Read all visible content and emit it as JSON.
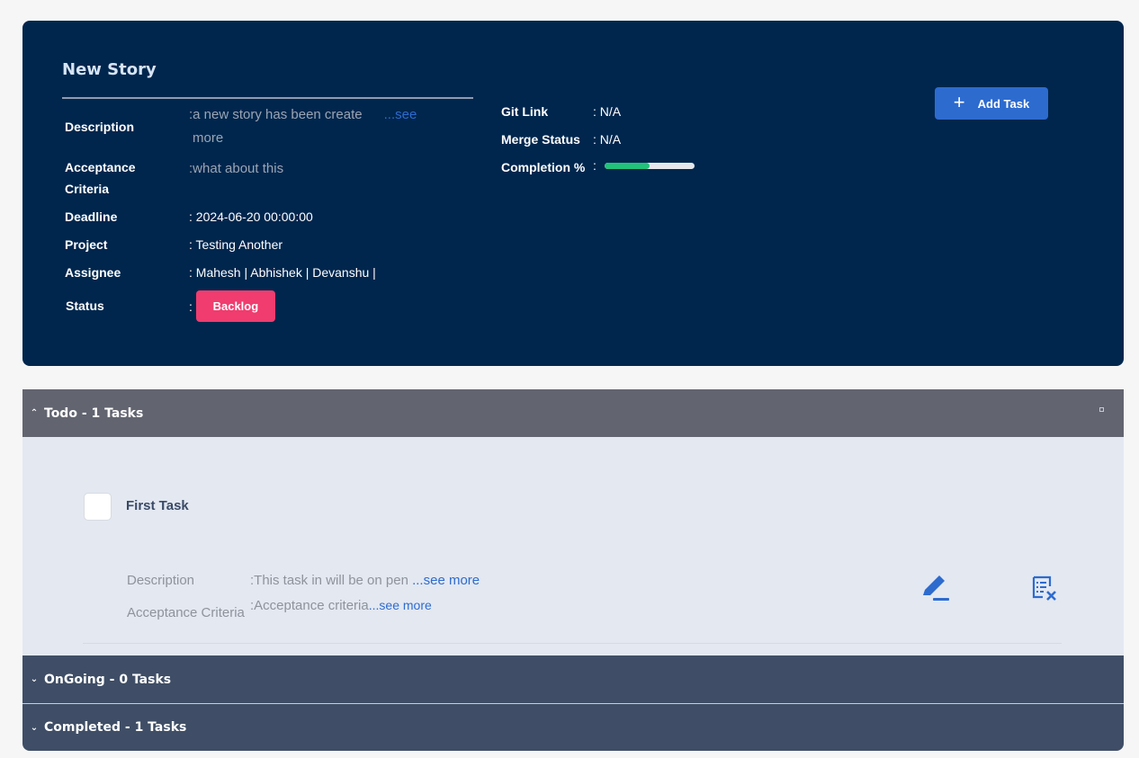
{
  "story": {
    "title": "New Story",
    "labels": {
      "description": "Description",
      "acceptance_line1": "Acceptance",
      "acceptance_line2": "Criteria",
      "deadline": "Deadline",
      "project": "Project",
      "assignee": "Assignee",
      "status": "Status",
      "git_link": "Git Link",
      "merge_status": "Merge Status",
      "completion": "Completion %"
    },
    "description_text": "a new story has been create",
    "see_more_1": "...see",
    "see_more_2": "more",
    "acceptance_text": "what about this",
    "deadline": ": 2024-06-20 00:00:00",
    "project": ": Testing Another",
    "assignee": ": Mahesh | Abhishek | Devanshu |",
    "status_colon": ":",
    "status_badge": "Backlog",
    "git_link": ": N/A",
    "merge_status": ": N/A",
    "completion_colon": ":",
    "completion_fraction": 0.5,
    "add_task_label": "Add Task",
    "colors": {
      "card_bg": "#00264d",
      "accent": "#2d6bcf",
      "badge": "#f03c6e",
      "progress": "#22c27a"
    }
  },
  "sections": {
    "todo": "Todo - 1 Tasks",
    "ongoing": "OnGoing - 0 Tasks",
    "completed": "Completed - 1 Tasks"
  },
  "task": {
    "title": "First Task",
    "description_label": "Description",
    "description_text": ":This task in will be on pen ",
    "description_see_more": "...see more",
    "acceptance_label": "Acceptance Criteria",
    "acceptance_text": ":Acceptance criteria",
    "acceptance_see_more": "...see more"
  },
  "icons": {
    "add": "plus-icon",
    "expand": "chevron-up-icon",
    "collapse": "chevron-down-icon",
    "edit": "pen-icon",
    "delete": "list-delete-icon"
  }
}
